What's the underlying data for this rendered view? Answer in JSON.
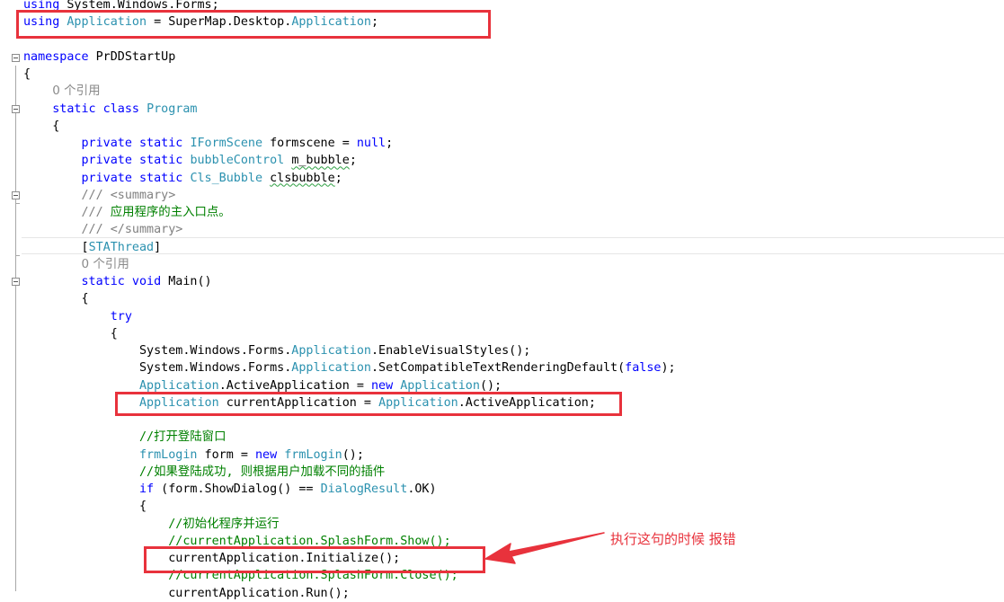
{
  "code_lines": [
    {
      "id": "l01",
      "tokens": [
        [
          "kw",
          "using"
        ],
        [
          "pl",
          " System.Windows.Forms;"
        ]
      ]
    },
    {
      "id": "l02",
      "tokens": [
        [
          "kw",
          "using"
        ],
        [
          "pl",
          " "
        ],
        [
          "ty",
          "Application"
        ],
        [
          "pl",
          " = SuperMap.Desktop."
        ],
        [
          "ty",
          "Application"
        ],
        [
          "pl",
          ";"
        ]
      ]
    },
    {
      "id": "l03",
      "tokens": []
    },
    {
      "id": "l04",
      "tokens": [
        [
          "kw",
          "namespace"
        ],
        [
          "pl",
          " PrDDStartUp"
        ]
      ]
    },
    {
      "id": "l05",
      "tokens": [
        [
          "pl",
          "{"
        ]
      ]
    },
    {
      "id": "l06",
      "tokens": [
        [
          "pl",
          "    "
        ],
        [
          "ref",
          "0 个引用"
        ]
      ]
    },
    {
      "id": "l07",
      "tokens": [
        [
          "pl",
          "    "
        ],
        [
          "kw",
          "static class"
        ],
        [
          "pl",
          " "
        ],
        [
          "ty",
          "Program"
        ]
      ]
    },
    {
      "id": "l08",
      "tokens": [
        [
          "pl",
          "    {"
        ]
      ]
    },
    {
      "id": "l09",
      "tokens": [
        [
          "pl",
          "        "
        ],
        [
          "kw",
          "private static"
        ],
        [
          "pl",
          " "
        ],
        [
          "ty",
          "IFormScene"
        ],
        [
          "pl",
          " formscene = "
        ],
        [
          "kw",
          "null"
        ],
        [
          "pl",
          ";"
        ]
      ]
    },
    {
      "id": "l10",
      "tokens": [
        [
          "pl",
          "        "
        ],
        [
          "kw",
          "private static"
        ],
        [
          "pl",
          " "
        ],
        [
          "ty",
          "bubbleControl"
        ],
        [
          "pl",
          " "
        ],
        [
          "sq",
          "m_bubble"
        ],
        [
          "pl",
          ";"
        ]
      ]
    },
    {
      "id": "l11",
      "tokens": [
        [
          "pl",
          "        "
        ],
        [
          "kw",
          "private static"
        ],
        [
          "pl",
          " "
        ],
        [
          "ty",
          "Cls_Bubble"
        ],
        [
          "pl",
          " "
        ],
        [
          "sq",
          "clsbubble"
        ],
        [
          "pl",
          ";"
        ]
      ]
    },
    {
      "id": "l12",
      "tokens": [
        [
          "pl",
          "        "
        ],
        [
          "xc",
          "/// <summary>"
        ]
      ]
    },
    {
      "id": "l13",
      "tokens": [
        [
          "pl",
          "        "
        ],
        [
          "xc",
          "/// "
        ],
        [
          "cm",
          "应用程序的主入口点。"
        ]
      ]
    },
    {
      "id": "l14",
      "tokens": [
        [
          "pl",
          "        "
        ],
        [
          "xc",
          "/// </summary>"
        ]
      ]
    },
    {
      "id": "l15",
      "tokens": [
        [
          "pl",
          "        ["
        ],
        [
          "ty",
          "STAThread"
        ],
        [
          "pl",
          "]"
        ]
      ]
    },
    {
      "id": "l16",
      "tokens": [
        [
          "pl",
          "        "
        ],
        [
          "ref",
          "0 个引用"
        ]
      ]
    },
    {
      "id": "l17",
      "tokens": [
        [
          "pl",
          "        "
        ],
        [
          "kw",
          "static void"
        ],
        [
          "pl",
          " Main()"
        ]
      ]
    },
    {
      "id": "l18",
      "tokens": [
        [
          "pl",
          "        {"
        ]
      ]
    },
    {
      "id": "l19",
      "tokens": [
        [
          "pl",
          "            "
        ],
        [
          "kw",
          "try"
        ]
      ]
    },
    {
      "id": "l20",
      "tokens": [
        [
          "pl",
          "            {"
        ]
      ]
    },
    {
      "id": "l21",
      "tokens": [
        [
          "pl",
          "                System.Windows.Forms."
        ],
        [
          "ty",
          "Application"
        ],
        [
          "pl",
          ".EnableVisualStyles();"
        ]
      ]
    },
    {
      "id": "l22",
      "tokens": [
        [
          "pl",
          "                System.Windows.Forms."
        ],
        [
          "ty",
          "Application"
        ],
        [
          "pl",
          ".SetCompatibleTextRenderingDefault("
        ],
        [
          "kw",
          "false"
        ],
        [
          "pl",
          ");"
        ]
      ]
    },
    {
      "id": "l23",
      "tokens": [
        [
          "pl",
          "                "
        ],
        [
          "ty",
          "Application"
        ],
        [
          "pl",
          ".ActiveApplication = "
        ],
        [
          "kw",
          "new"
        ],
        [
          "pl",
          " "
        ],
        [
          "ty",
          "Application"
        ],
        [
          "pl",
          "();"
        ]
      ]
    },
    {
      "id": "l24",
      "tokens": [
        [
          "pl",
          "                "
        ],
        [
          "ty",
          "Application"
        ],
        [
          "pl",
          " currentApplication = "
        ],
        [
          "ty",
          "Application"
        ],
        [
          "pl",
          ".ActiveApplication;"
        ]
      ]
    },
    {
      "id": "l25",
      "tokens": []
    },
    {
      "id": "l26",
      "tokens": [
        [
          "pl",
          "                "
        ],
        [
          "cm",
          "//打开登陆窗口"
        ]
      ]
    },
    {
      "id": "l27",
      "tokens": [
        [
          "pl",
          "                "
        ],
        [
          "ty",
          "frmLogin"
        ],
        [
          "pl",
          " form = "
        ],
        [
          "kw",
          "new"
        ],
        [
          "pl",
          " "
        ],
        [
          "ty",
          "frmLogin"
        ],
        [
          "pl",
          "();"
        ]
      ]
    },
    {
      "id": "l28",
      "tokens": [
        [
          "pl",
          "                "
        ],
        [
          "cm",
          "//如果登陆成功, 则根据用户加载不同的插件"
        ]
      ]
    },
    {
      "id": "l29",
      "tokens": [
        [
          "pl",
          "                "
        ],
        [
          "kw",
          "if"
        ],
        [
          "pl",
          " (form.ShowDialog() == "
        ],
        [
          "ty",
          "DialogResult"
        ],
        [
          "pl",
          ".OK)"
        ]
      ]
    },
    {
      "id": "l30",
      "tokens": [
        [
          "pl",
          "                {"
        ]
      ]
    },
    {
      "id": "l31",
      "tokens": [
        [
          "pl",
          "                    "
        ],
        [
          "cm",
          "//初始化程序并运行"
        ]
      ]
    },
    {
      "id": "l32",
      "tokens": [
        [
          "pl",
          "                    "
        ],
        [
          "cm",
          "//currentApplication.SplashForm.Show();"
        ]
      ]
    },
    {
      "id": "l33",
      "tokens": [
        [
          "pl",
          "                    currentApplication.Initialize();"
        ]
      ]
    },
    {
      "id": "l34",
      "tokens": [
        [
          "pl",
          "                    "
        ],
        [
          "cm",
          "//currentApplication.SplashForm.Close();"
        ]
      ]
    },
    {
      "id": "l35",
      "tokens": [
        [
          "pl",
          "                    currentApplication.Run();"
        ]
      ]
    }
  ],
  "annotation": {
    "text": "执行这句的时候 报错",
    "color": "#e8323c"
  },
  "colors": {
    "keyword": "#0000ff",
    "type": "#2b91af",
    "comment": "#008000",
    "reference": "#8a8a8a",
    "highlight_box": "#e8323c"
  }
}
